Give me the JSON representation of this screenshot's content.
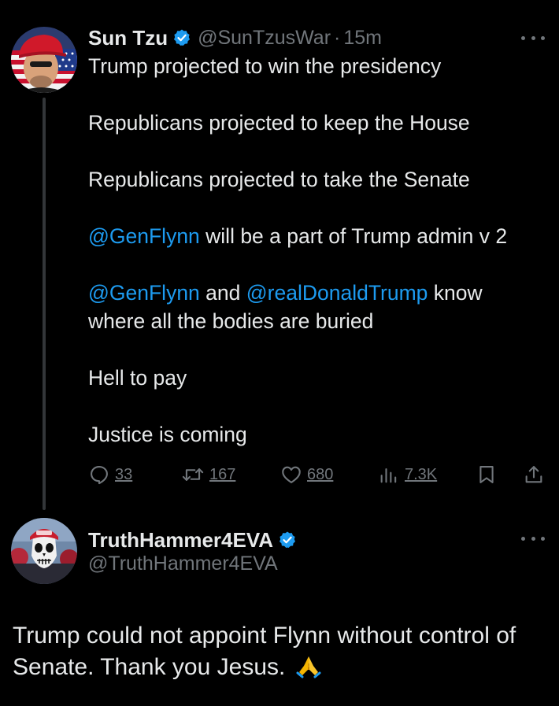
{
  "colors": {
    "background": "#000000",
    "text": "#e7e9ea",
    "muted": "#71767b",
    "link": "#1d9bf0",
    "verified": "#1d9bf0",
    "thread_line": "#333639"
  },
  "tweet": {
    "author": {
      "name": "Sun Tzu",
      "handle": "@SunTzusWar",
      "separator": "·",
      "time": "15m",
      "verified_icon": "verified-badge-icon"
    },
    "paragraphs": {
      "p1": "Trump projected to win the presidency",
      "p2": "Republicans projected to keep the House",
      "p3": "Republicans projected to take the Senate",
      "p4_mention": "@GenFlynn",
      "p4_rest": " will be a part of Trump admin v 2",
      "p5_mention1": "@GenFlynn",
      "p5_and": " and ",
      "p5_mention2": "@realDonaldTrump",
      "p5_rest1": " know",
      "p5_rest2": "where all the bodies are buried",
      "p6": "Hell to pay",
      "p7": "Justice is coming"
    },
    "actions": {
      "replies": "33",
      "retweets": "167",
      "likes": "680",
      "views": "7.3K"
    }
  },
  "reply": {
    "author": {
      "name": "TruthHammer4EVA",
      "handle": "@TruthHammer4EVA",
      "verified_icon": "verified-badge-icon"
    },
    "text": "Trump could not appoint Flynn without control of Senate. Thank you Jesus.",
    "emoji_icon": "folded-hands-icon"
  }
}
